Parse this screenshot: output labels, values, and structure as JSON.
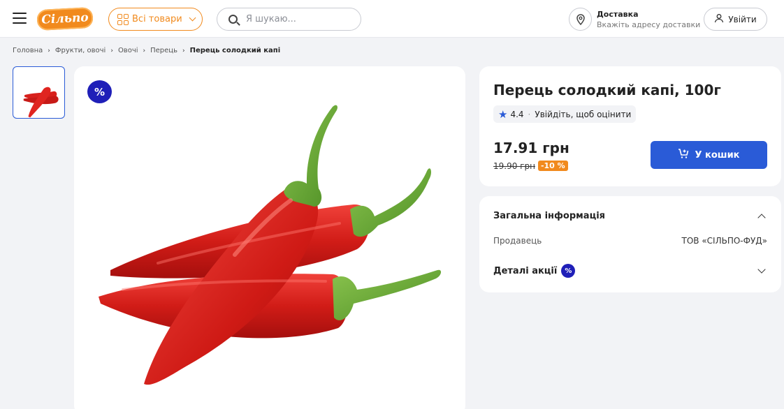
{
  "header": {
    "logo_text": "Сільпо",
    "catalog_label": "Всі товари",
    "search_placeholder": "Я шукаю...",
    "delivery_title": "Доставка",
    "delivery_subtitle": "Вкажіть адресу доставки",
    "login_label": "Увійти"
  },
  "breadcrumb": {
    "items": [
      "Головна",
      "Фрукти, овочі",
      "Овочі",
      "Перець"
    ],
    "current": "Перець солодкий капі"
  },
  "product": {
    "title": "Перець солодкий капі, 100г",
    "rating": "4.4",
    "rate_prompt": "Увійдіть, щоб оцінити",
    "price": "17.91 грн",
    "old_price": "19.90 грн",
    "discount": "-10 %",
    "cart_label": "У кошик",
    "promo_badge": "%"
  },
  "details": {
    "general_title": "Загальна інформація",
    "seller_label": "Продавець",
    "seller_value": "ТОВ «СІЛЬПО-ФУД»",
    "promo_title": "Деталі акції",
    "promo_badge": "%"
  },
  "colors": {
    "accent_orange": "#f18a1d",
    "primary_blue": "#2a5bd7",
    "promo_navy": "#1f1fb8"
  }
}
